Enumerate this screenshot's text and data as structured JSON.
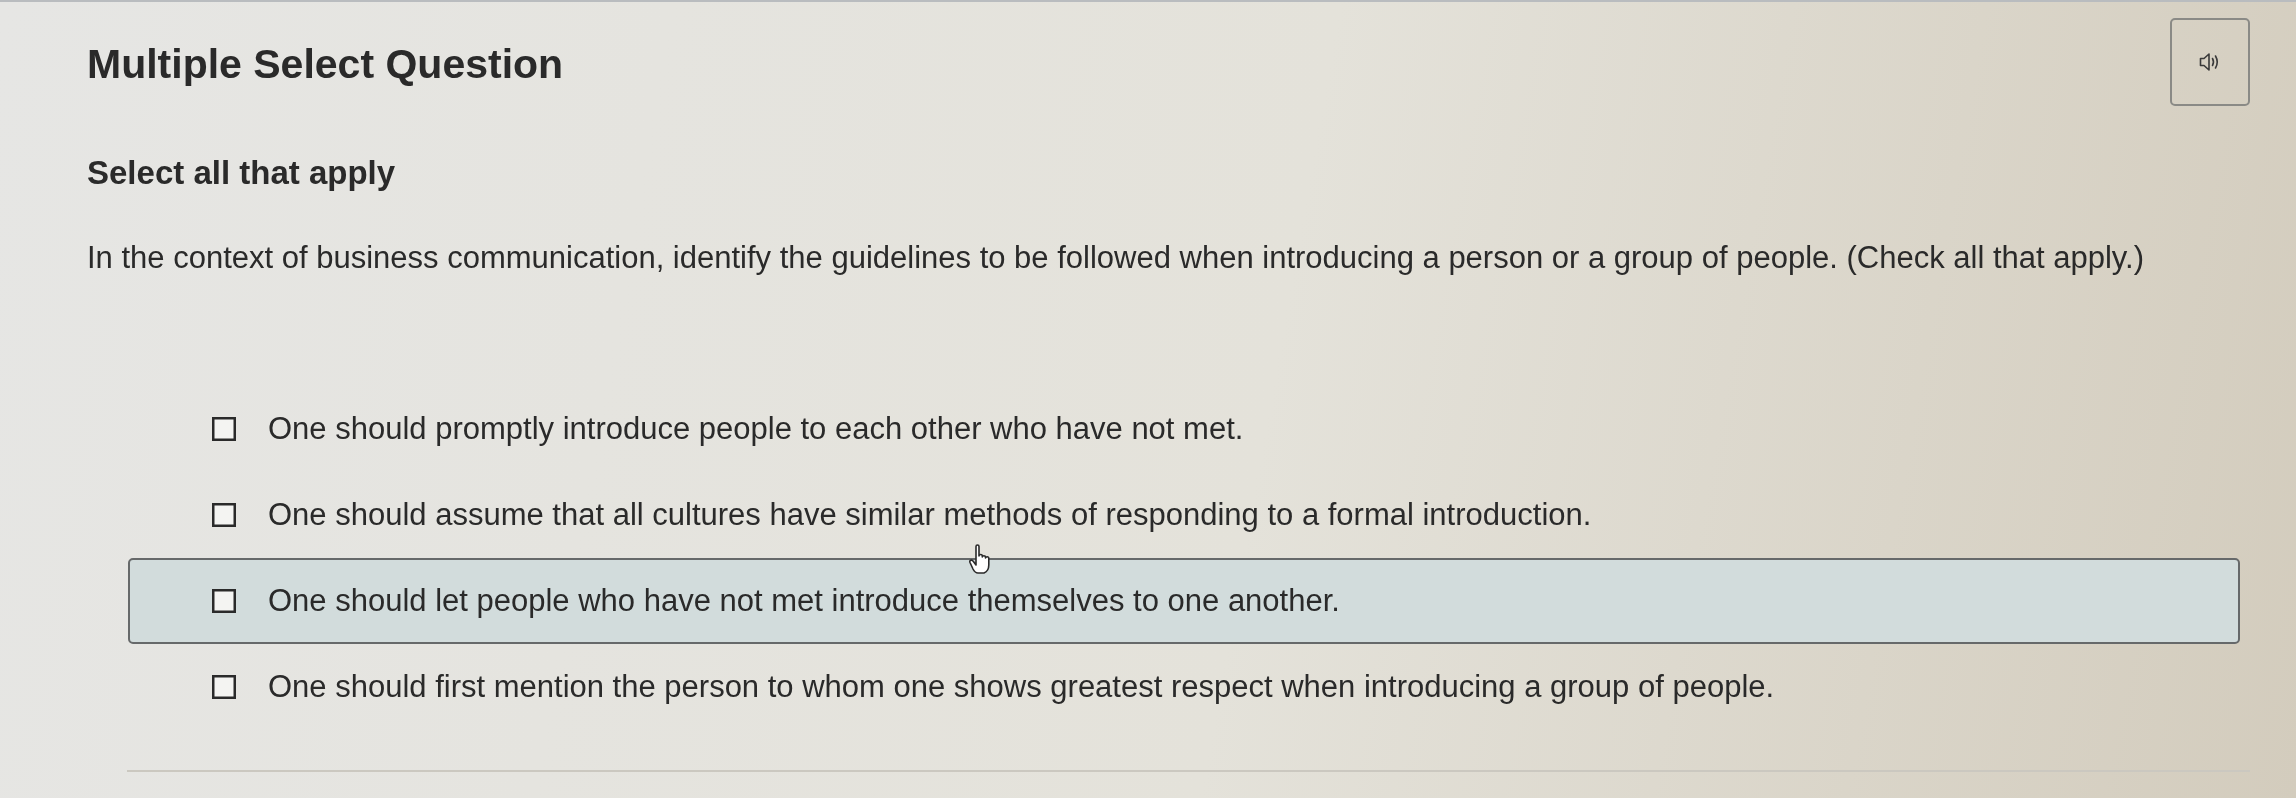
{
  "question_type": "Multiple Select Question",
  "instruction": "Select all that apply",
  "prompt": "In the context of business communication, identify the guidelines to be followed when introducing a person or a group of people. (Check all that apply.)",
  "options": [
    {
      "label": "One should promptly introduce people to each other who have not met.",
      "checked": false,
      "hovered": false
    },
    {
      "label": "One should assume that all cultures have similar methods of responding to a formal introduction.",
      "checked": false,
      "hovered": false
    },
    {
      "label": "One should let people who have not met introduce themselves to one another.",
      "checked": false,
      "hovered": true
    },
    {
      "label": "One should first mention the person to whom one shows greatest respect when introducing a group of people.",
      "checked": false,
      "hovered": false
    }
  ]
}
